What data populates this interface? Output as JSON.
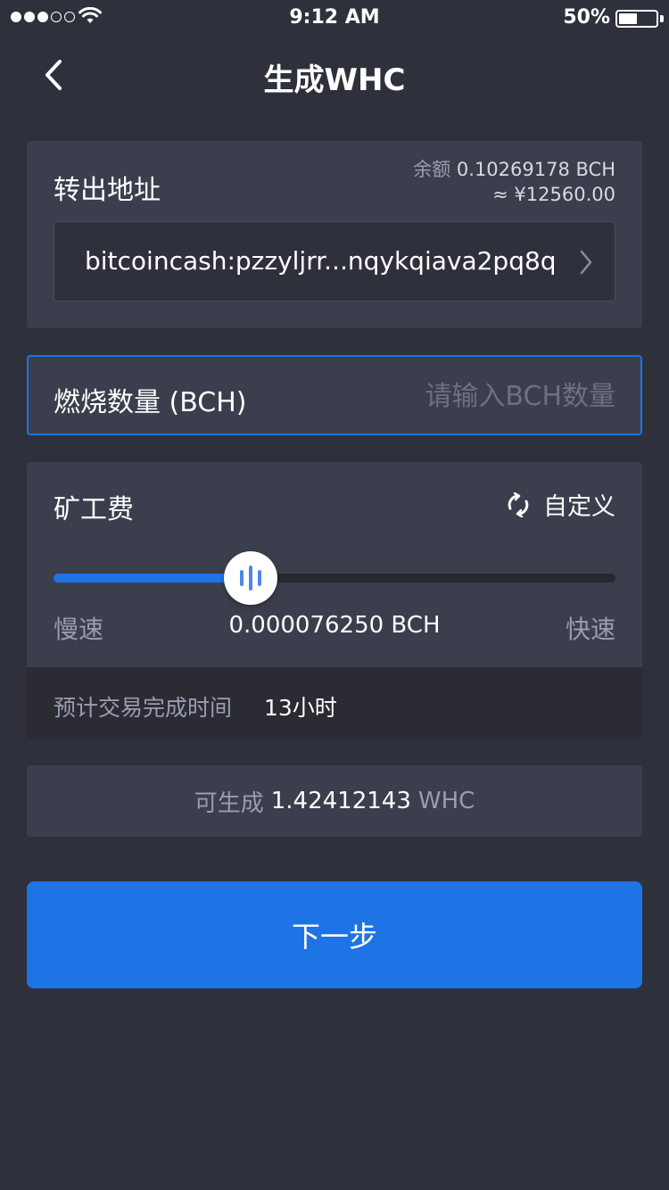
{
  "status_bar": {
    "time": "9:12 AM",
    "battery_percent_text": "50%",
    "battery_level": 0.5,
    "signal_bars_filled": 3,
    "signal_bars_total": 5
  },
  "nav": {
    "title": "生成WHC"
  },
  "address_card": {
    "label": "转出地址",
    "balance_label": "余额",
    "balance_value": "0.10269178 BCH",
    "balance_fiat": "≈ ¥12560.00",
    "address": "bitcoincash:pzzyljrr...nqykqiava2pq8q"
  },
  "burn": {
    "label": "燃烧数量 (BCH)",
    "placeholder": "请输入BCH数量",
    "value": ""
  },
  "fee": {
    "label": "矿工费",
    "custom_label": "自定义",
    "slow_label": "慢速",
    "fast_label": "快速",
    "fee_value": "0.000076250 BCH",
    "slider_fraction": 0.35,
    "eta_label": "预计交易完成时间",
    "eta_value": "13小时"
  },
  "generate": {
    "prefix": "可生成",
    "amount": "1.42412143",
    "unit": "WHC"
  },
  "next_button": {
    "label": "下一步"
  },
  "colors": {
    "background": "#2e313c",
    "card": "#3b3e4c",
    "accent": "#1e74e4",
    "muted_text": "#9a9db0"
  },
  "icons": [
    "back-chevron-icon",
    "wifi-icon",
    "battery-icon",
    "chevron-right-icon",
    "refresh-icon"
  ]
}
